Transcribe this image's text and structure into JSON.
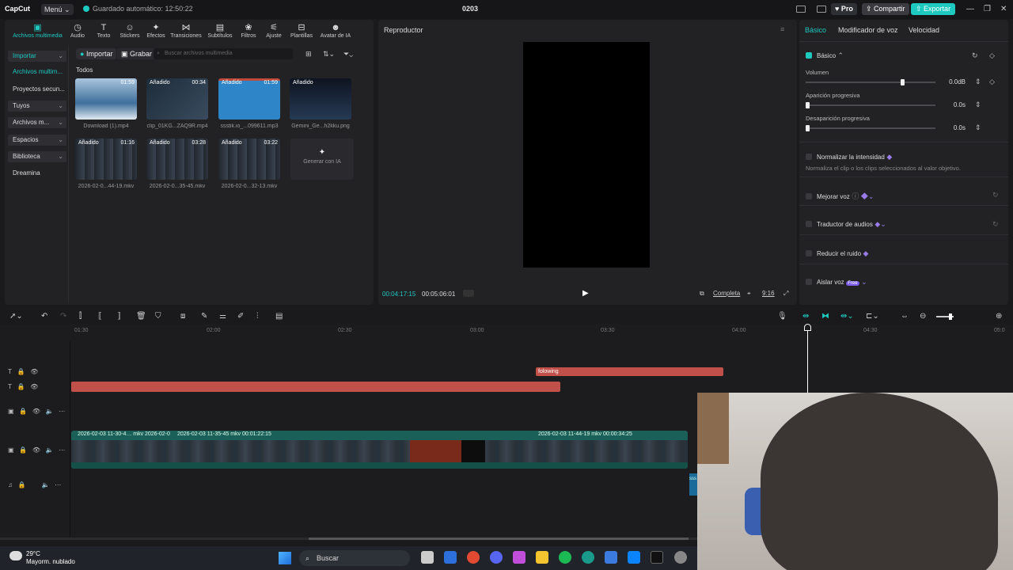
{
  "titlebar": {
    "logo": "CapCut",
    "menu": "Menú",
    "autosave": "Guardado automático: 12:50:22",
    "project": "0203",
    "pro": "Pro",
    "share": "Compartir",
    "export": "Exportar"
  },
  "media": {
    "tabs": [
      {
        "label": "Archivos multimedia",
        "icon": "media-icon"
      },
      {
        "label": "Audio",
        "icon": "audio-icon"
      },
      {
        "label": "Texto",
        "icon": "text-icon"
      },
      {
        "label": "Stickers",
        "icon": "sticker-icon"
      },
      {
        "label": "Efectos",
        "icon": "effects-icon"
      },
      {
        "label": "Transiciones",
        "icon": "transitions-icon"
      },
      {
        "label": "Subtítulos",
        "icon": "subtitles-icon"
      },
      {
        "label": "Filtros",
        "icon": "filters-icon"
      },
      {
        "label": "Ajuste",
        "icon": "adjust-icon"
      },
      {
        "label": "Plantillas",
        "icon": "templates-icon"
      },
      {
        "label": "Avatar de IA",
        "icon": "ai-avatar-icon"
      }
    ],
    "sidebar": [
      {
        "label": "Importar"
      },
      {
        "label": "Archivos multim..."
      },
      {
        "label": "Proyectos secun..."
      },
      {
        "label": "Tuyos"
      },
      {
        "label": "Archivos m..."
      },
      {
        "label": "Espacios"
      },
      {
        "label": "Biblioteca"
      },
      {
        "label": "Dreamina"
      }
    ],
    "import_btn": "Importar",
    "record_btn": "Grabar",
    "search_placeholder": "Buscar archivos multimedia",
    "section": "Todos",
    "items": [
      {
        "name": "Download (1).mp4",
        "duration": "01:59",
        "badge": ""
      },
      {
        "name": "clip_01KG...ZAQ9R.mp4",
        "duration": "00:34",
        "badge": "Añadido"
      },
      {
        "name": "ssstik.io_...099611.mp3",
        "duration": "01:59",
        "badge": "Añadido"
      },
      {
        "name": "Gemini_Ge...h2kku.png",
        "duration": "",
        "badge": "Añadido"
      },
      {
        "name": "2026-02-0...44-19.mkv",
        "duration": "01:16",
        "badge": "Añadido"
      },
      {
        "name": "2026-02-0...35-45.mkv",
        "duration": "03:28",
        "badge": "Añadido"
      },
      {
        "name": "2026-02-0...32-13.mkv",
        "duration": "03:22",
        "badge": "Añadido"
      }
    ],
    "gen_ai": "Generar con IA"
  },
  "player": {
    "title": "Reproductor",
    "current_time": "00:04:17:15",
    "total_time": "00:05:06:01",
    "complete": "Completa",
    "ratio": "9:16"
  },
  "props": {
    "tabs": [
      "Básico",
      "Modificador de voz",
      "Velocidad"
    ],
    "section": "Básico",
    "volume": {
      "label": "Volumen",
      "value": "0.0dB",
      "level": 0.73
    },
    "fade_in": {
      "label": "Aparición progresiva",
      "value": "0.0s"
    },
    "fade_out": {
      "label": "Desaparición progresiva",
      "value": "0.0s"
    },
    "normalize": "Normalizar la intensidad",
    "normalize_desc": "Normaliza el clip o los clips seleccionados al valor objetivo.",
    "enhance": "Mejorar voz",
    "translate": "Traductor de audios",
    "denoise": "Reducir el ruido",
    "isolate": "Aislar voz",
    "free_badge": "Free"
  },
  "timeline": {
    "ruler": [
      "01:30",
      "02:00",
      "02:30",
      "03:00",
      "03:30",
      "04:00",
      "04:30",
      "05:0"
    ],
    "text_clip_label": "folowing",
    "video_labels": [
      "2026-02-03 11-30-4… mkv",
      "2026-02-0",
      "2026-02-03 11-35-45 mkv  00:01:22:15",
      "2026-02-03 11-44-19 mkv  00:00:34:25"
    ],
    "audio_label": "sss"
  },
  "taskbar": {
    "temp": "29°C",
    "weather": "Mayorm. nublado",
    "search": "Buscar"
  }
}
